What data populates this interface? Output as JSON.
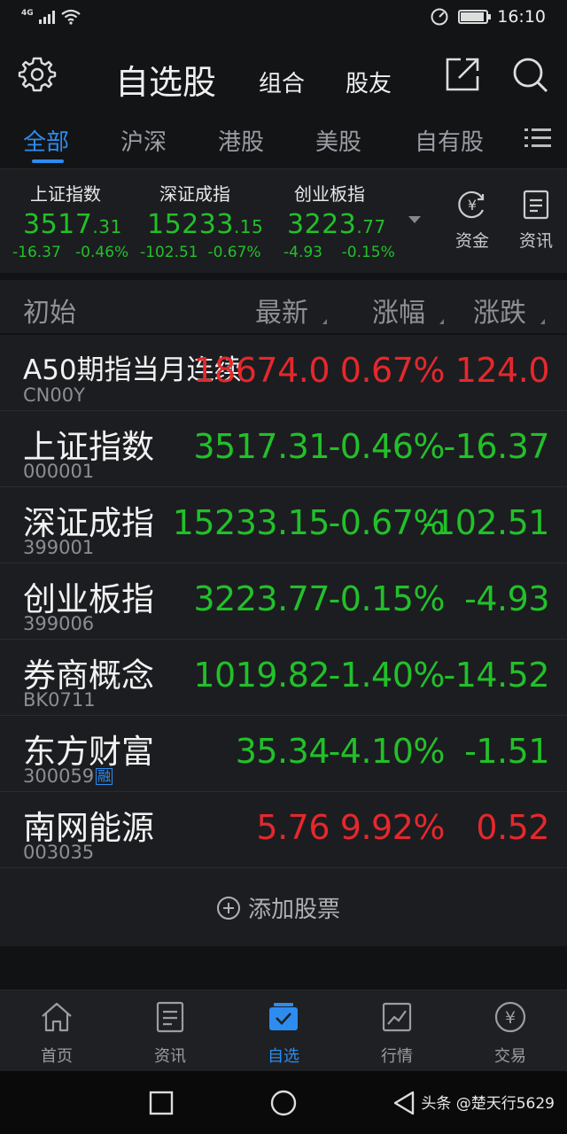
{
  "status_bar": {
    "network": "4G",
    "time": "16:10",
    "battery_level": 0.85
  },
  "header": {
    "title": "自选股",
    "combo_label": "组合",
    "friends_label": "股友",
    "icons": [
      "gear-icon",
      "share-icon",
      "search-icon"
    ]
  },
  "tabs": [
    {
      "label": "全部",
      "active": true
    },
    {
      "label": "沪深",
      "active": false
    },
    {
      "label": "港股",
      "active": false
    },
    {
      "label": "美股",
      "active": false
    },
    {
      "label": "自有股",
      "active": false
    }
  ],
  "indices": [
    {
      "name": "上证指数",
      "price_int": "3517",
      "price_dec": ".31",
      "change": "-16.37",
      "pct": "-0.46%"
    },
    {
      "name": "深证成指",
      "price_int": "15233",
      "price_dec": ".15",
      "change": "-102.51",
      "pct": "-0.67%"
    },
    {
      "name": "创业板指",
      "price_int": "3223",
      "price_dec": ".77",
      "change": "-4.93",
      "pct": "-0.15%"
    }
  ],
  "index_side": {
    "funds_label": "资金",
    "news_label": "资讯"
  },
  "columns": {
    "name": "初始",
    "price": "最新",
    "pct": "涨幅",
    "change": "涨跌"
  },
  "stocks": [
    {
      "name": "A50期指当月连续",
      "code": "CN00Y",
      "price": "18674.0",
      "pct": "0.67%",
      "change": "124.0",
      "dir": "up",
      "badge": ""
    },
    {
      "name": "上证指数",
      "code": "000001",
      "price": "3517.31",
      "pct": "-0.46%",
      "change": "-16.37",
      "dir": "down",
      "badge": ""
    },
    {
      "name": "深证成指",
      "code": "399001",
      "price": "15233.15",
      "pct": "-0.67%",
      "change": "-102.51",
      "dir": "down",
      "badge": ""
    },
    {
      "name": "创业板指",
      "code": "399006",
      "price": "3223.77",
      "pct": "-0.15%",
      "change": "-4.93",
      "dir": "down",
      "badge": ""
    },
    {
      "name": "券商概念",
      "code": "BK0711",
      "price": "1019.82",
      "pct": "-1.40%",
      "change": "-14.52",
      "dir": "down",
      "badge": ""
    },
    {
      "name": "东方财富",
      "code": "300059",
      "price": "35.34",
      "pct": "-4.10%",
      "change": "-1.51",
      "dir": "down",
      "badge": "融"
    },
    {
      "name": "南网能源",
      "code": "003035",
      "price": "5.76",
      "pct": "9.92%",
      "change": "0.52",
      "dir": "up",
      "badge": ""
    }
  ],
  "add_stock_label": "添加股票",
  "bottom_tabs": [
    {
      "label": "首页",
      "icon": "home-icon",
      "active": false
    },
    {
      "label": "资讯",
      "icon": "news-icon",
      "active": false
    },
    {
      "label": "自选",
      "icon": "watchlist-icon",
      "active": true
    },
    {
      "label": "行情",
      "icon": "market-chart-icon",
      "active": false
    },
    {
      "label": "交易",
      "icon": "trade-yen-icon",
      "active": false
    }
  ],
  "watermark": "头条 @楚天行5629",
  "colors": {
    "up": "#e5282d",
    "down": "#22c02a",
    "accent": "#2d8cf0"
  }
}
